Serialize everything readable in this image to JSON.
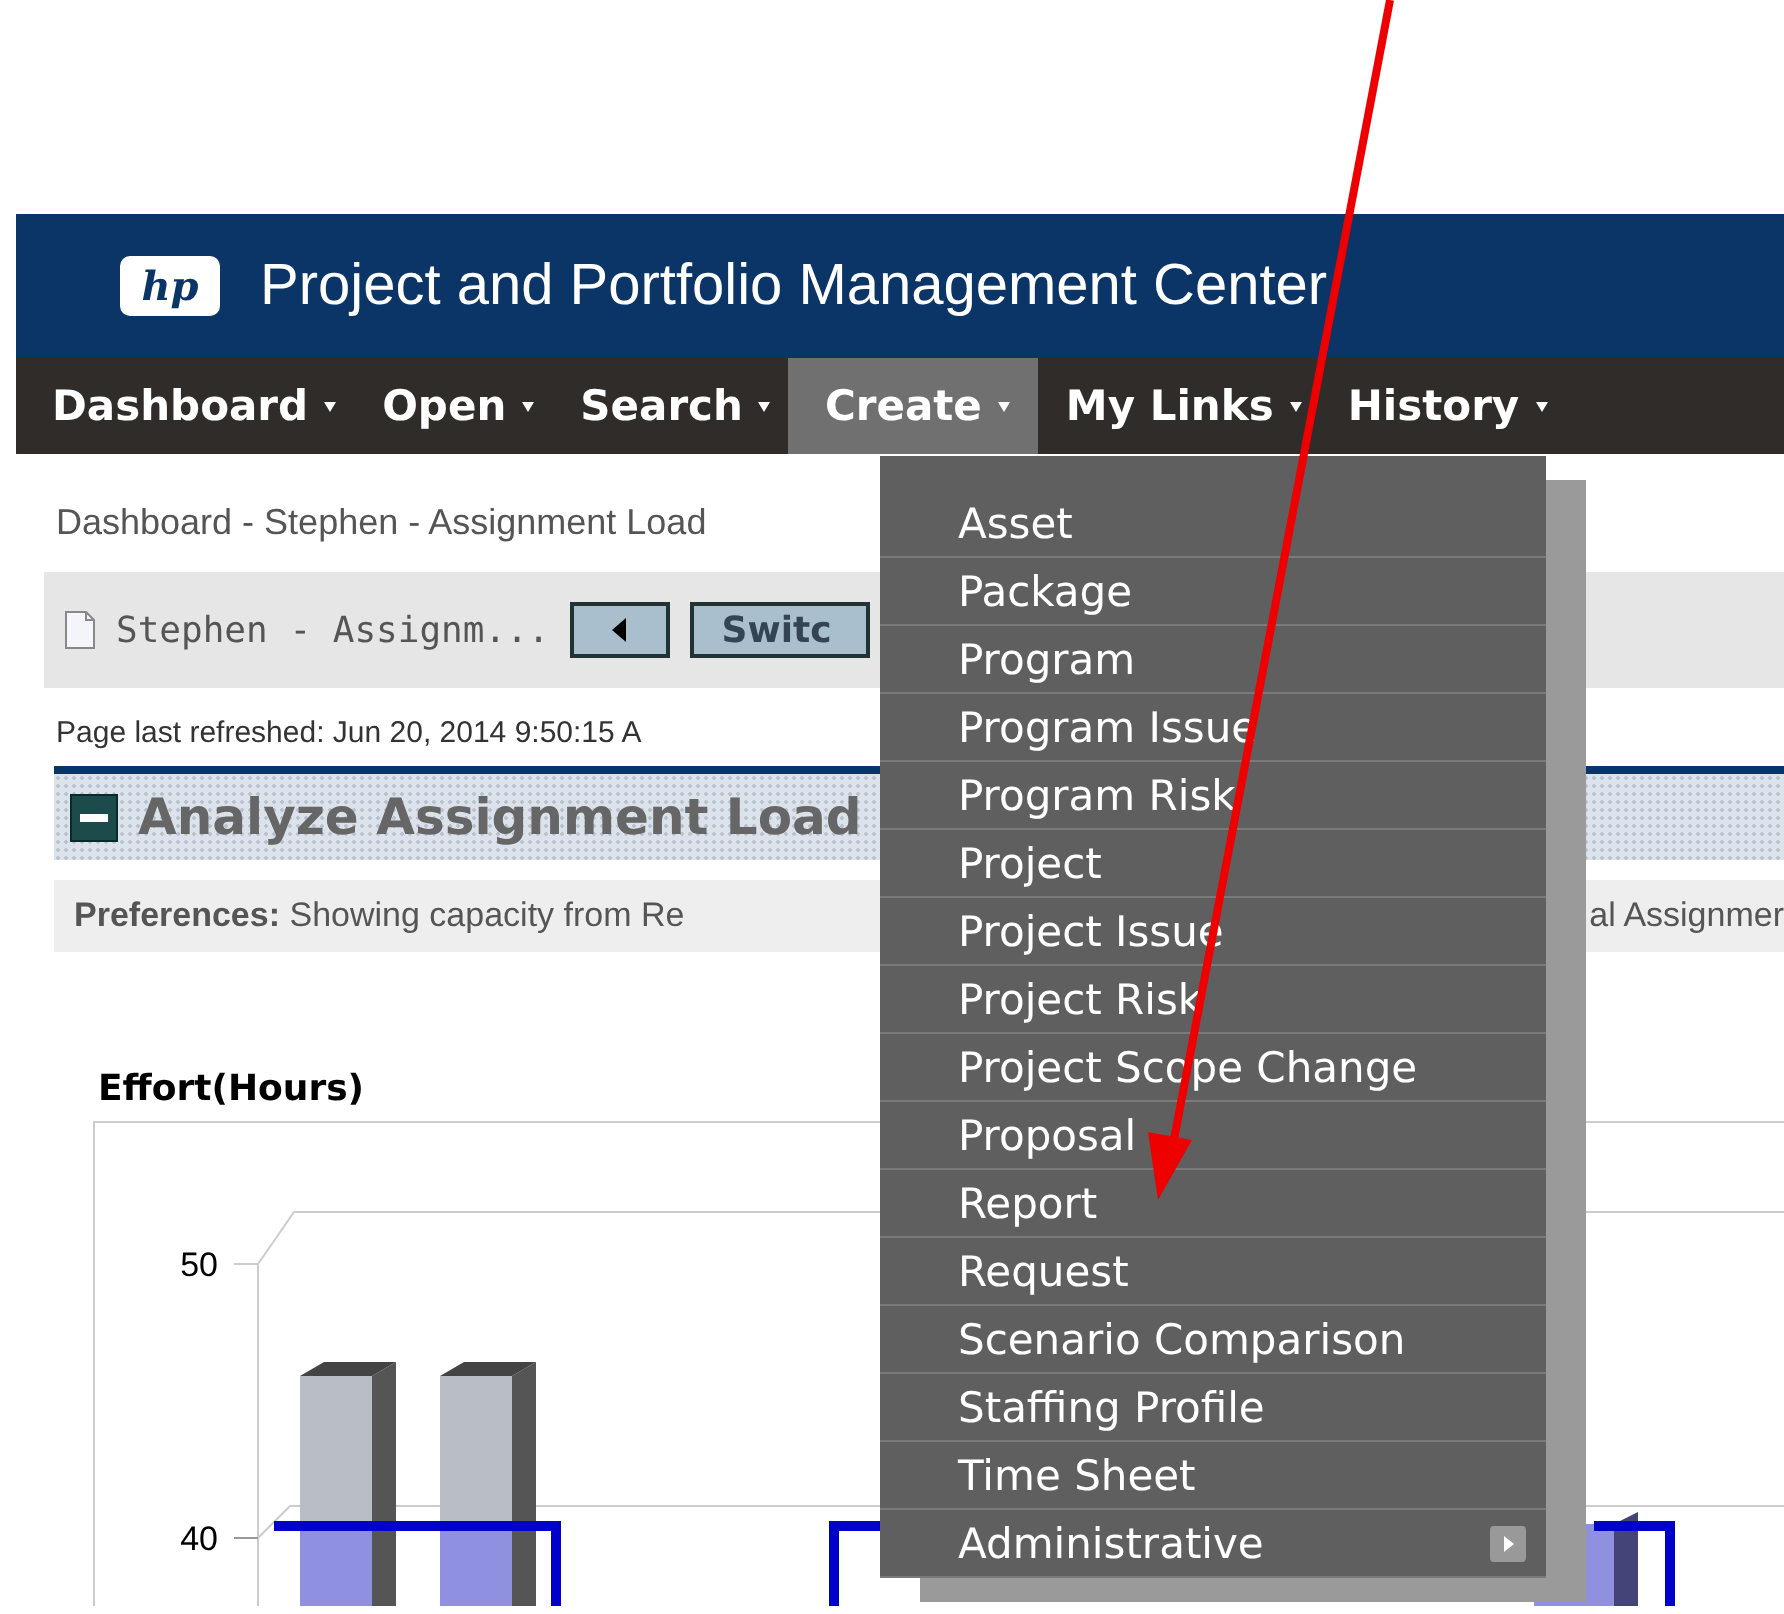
{
  "header": {
    "logo": "hp",
    "title": "Project and Portfolio Management Center"
  },
  "nav": [
    {
      "label": "Dashboard",
      "selected": false
    },
    {
      "label": "Open",
      "selected": false
    },
    {
      "label": "Search",
      "selected": false
    },
    {
      "label": "Create",
      "selected": true
    },
    {
      "label": "My Links",
      "selected": false
    },
    {
      "label": "History",
      "selected": false
    }
  ],
  "breadcrumb": "Dashboard - Stephen - Assignment Load",
  "toolbar": {
    "page_name": "Stephen - Assignm...",
    "switch_button": "Switc"
  },
  "refreshed": "Page last refreshed: Jun 20, 2014 9:50:15 A",
  "panel": {
    "title": "Analyze Assignment Load",
    "preferences": "**Preferences:** Showing capacity from Re",
    "preferences_tail": "al Assignmer",
    "y_axis_label": "Effort(Hours)",
    "y_ticks": [
      "50",
      "40"
    ]
  },
  "menu": {
    "items": [
      {
        "label": "Asset",
        "submenu": false
      },
      {
        "label": "Package",
        "submenu": false
      },
      {
        "label": "Program",
        "submenu": false
      },
      {
        "label": "Program Issue",
        "submenu": false
      },
      {
        "label": "Program Risk",
        "submenu": false
      },
      {
        "label": "Project",
        "submenu": false
      },
      {
        "label": "Project Issue",
        "submenu": false
      },
      {
        "label": "Project Risk",
        "submenu": false
      },
      {
        "label": "Project Scope Change",
        "submenu": false
      },
      {
        "label": "Proposal",
        "submenu": false
      },
      {
        "label": "Report",
        "submenu": false
      },
      {
        "label": "Request",
        "submenu": false
      },
      {
        "label": "Scenario Comparison",
        "submenu": false
      },
      {
        "label": "Staffing Profile",
        "submenu": false
      },
      {
        "label": "Time Sheet",
        "submenu": false
      },
      {
        "label": "Administrative",
        "submenu": true
      }
    ]
  }
}
